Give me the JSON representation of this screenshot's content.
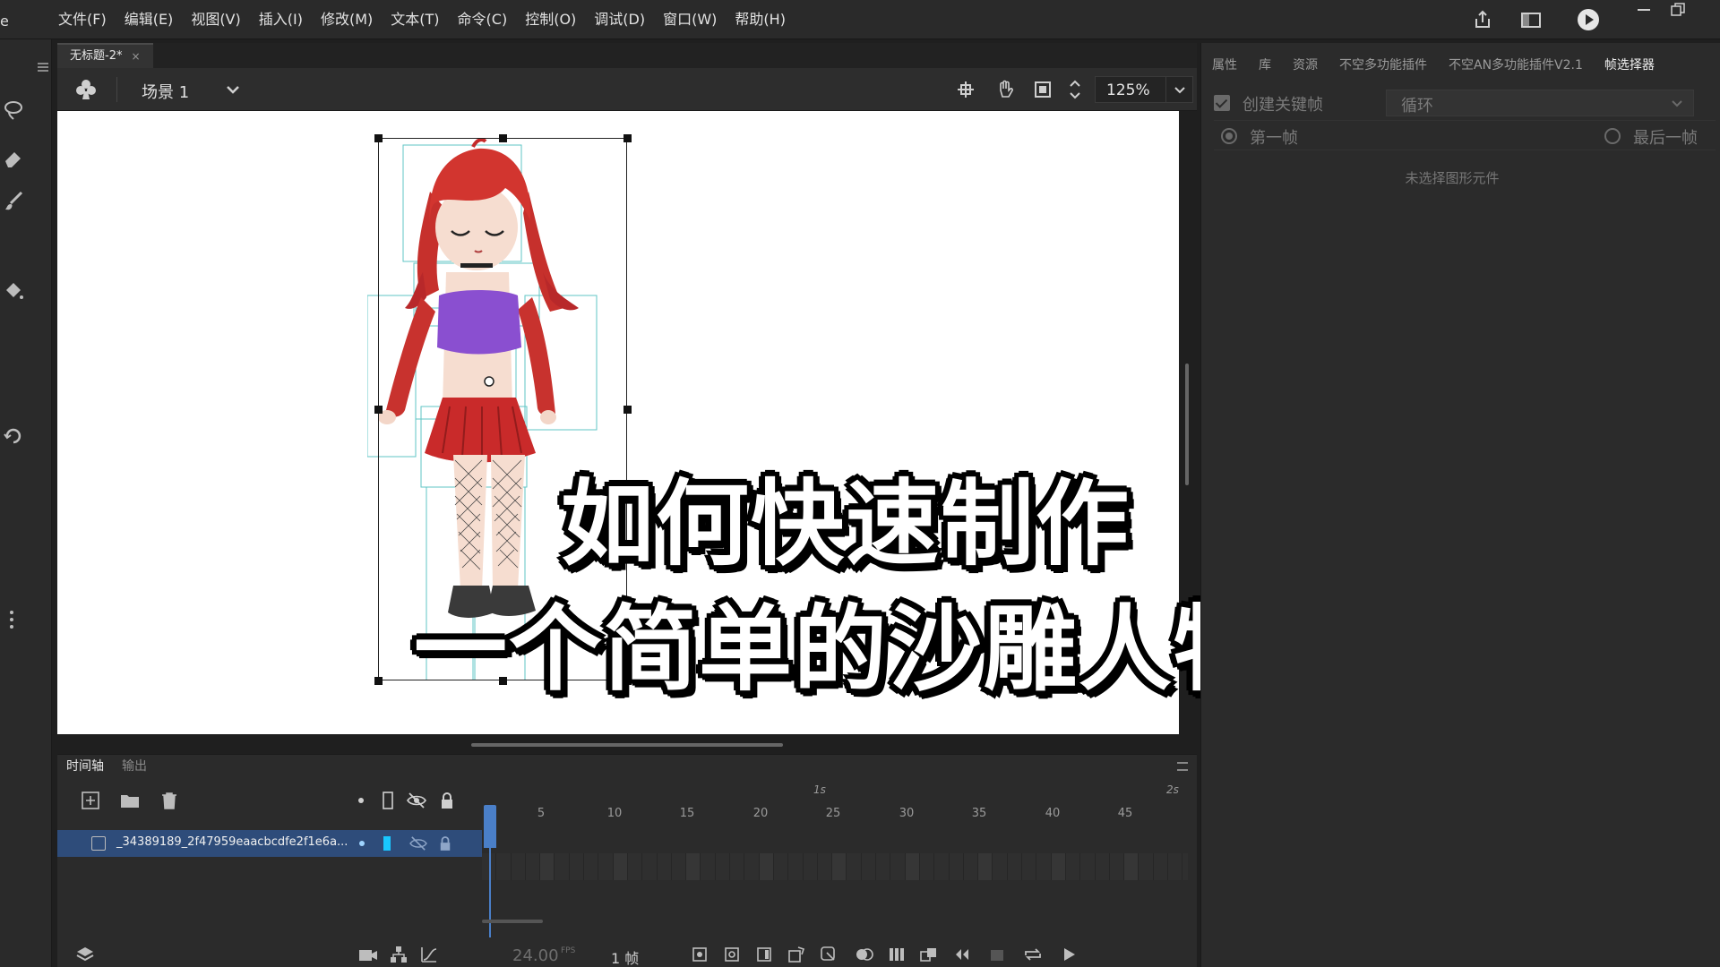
{
  "app": {
    "logo_fragment": "e"
  },
  "menubar": {
    "items": [
      "文件(F)",
      "编辑(E)",
      "视图(V)",
      "插入(I)",
      "修改(M)",
      "文本(T)",
      "命令(C)",
      "控制(O)",
      "调试(D)",
      "窗口(W)",
      "帮助(H)"
    ]
  },
  "document": {
    "tab_title": "无标题-2*",
    "tab_close": "×",
    "scene_name": "场景 1",
    "zoom": "125%"
  },
  "caption": {
    "line1": "如何快速制作",
    "line2": "一个简单的沙雕人物"
  },
  "right_panel": {
    "tabs": [
      "属性",
      "库",
      "资源",
      "不空多功能插件",
      "不空AN多功能插件V2.1",
      "帧选择器"
    ],
    "active_tab": "帧选择器",
    "create_keyframe_label": "创建关键帧",
    "loop_value": "循环",
    "first_frame_label": "第一帧",
    "last_frame_label": "最后一帧",
    "empty_message": "未选择图形元件"
  },
  "timeline": {
    "tabs": [
      "时间轴",
      "输出"
    ],
    "layer_name": "_34389189_2f47959eaacbcdfe2f1e6a...",
    "ruler_ticks": [
      "5",
      "10",
      "15",
      "20",
      "25",
      "30",
      "35",
      "40",
      "45"
    ],
    "seconds_labels": [
      "1s",
      "2s"
    ],
    "fps": "24.00",
    "fps_unit": "FPS",
    "current_frame": "1 帧"
  },
  "colors": {
    "accent_blue": "#4a7fc8",
    "selected_layer": "#2e4c7a",
    "panel_bg": "#2b2b2b",
    "stage_white": "#ffffff"
  }
}
